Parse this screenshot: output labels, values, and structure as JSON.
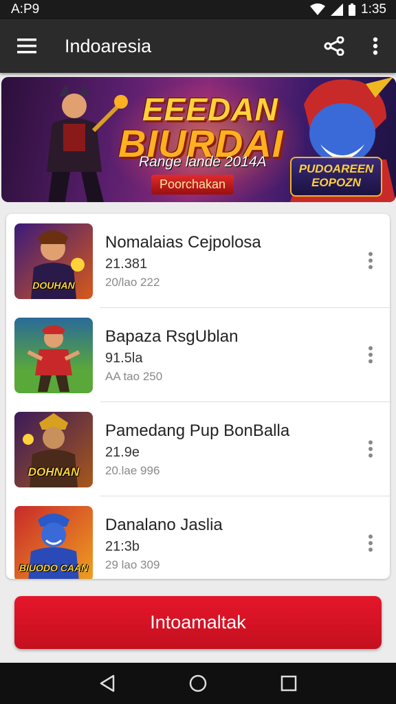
{
  "status_bar": {
    "time": "A:P9",
    "clock": "1:35"
  },
  "app_bar": {
    "title": "Indoaresia",
    "menu_icon": "hamburger-menu-icon",
    "share_icon": "share-icon",
    "overflow_icon": "overflow-menu-icon"
  },
  "banner": {
    "title_line1": "EEEDAN",
    "title_line2": "BIURDAI",
    "subtitle": "Range lande 2014A",
    "pill": "Poorchakan",
    "badge": "PUDOAREEN EOPOZN"
  },
  "list": {
    "items": [
      {
        "title": "Nomalaias Cejpolosa",
        "line2": "21.381",
        "line3": "20/lao 222",
        "thumb_label": "DOUHAN",
        "thumb_colors": [
          "#3a1a7a",
          "#d85a1a"
        ]
      },
      {
        "title": "Bapaza RsgUblan",
        "line2": "91.5la",
        "line3": "AA tao 250",
        "thumb_label": "",
        "thumb_colors": [
          "#2a6a9a",
          "#5aa83a"
        ]
      },
      {
        "title": "Pamedang Pup BonBalla",
        "line2": "21.9e",
        "line3": "20.lae 996",
        "thumb_label": "DOHNAN",
        "thumb_colors": [
          "#3a1a5a",
          "#a8581a"
        ]
      },
      {
        "title": "Danalano Jaslia",
        "line2": "21:3b",
        "line3": "29 lao 309",
        "thumb_label": "BIUODO CAAN",
        "thumb_colors": [
          "#c82a2a",
          "#f0a020"
        ]
      }
    ],
    "more_icon": "vertical-dots-icon"
  },
  "cta": {
    "label": "Intoamaltak",
    "color": "#e0142a"
  },
  "nav_bar": {
    "back_icon": "back-triangle-icon",
    "home_icon": "home-circle-icon",
    "recents_icon": "recents-square-icon"
  }
}
